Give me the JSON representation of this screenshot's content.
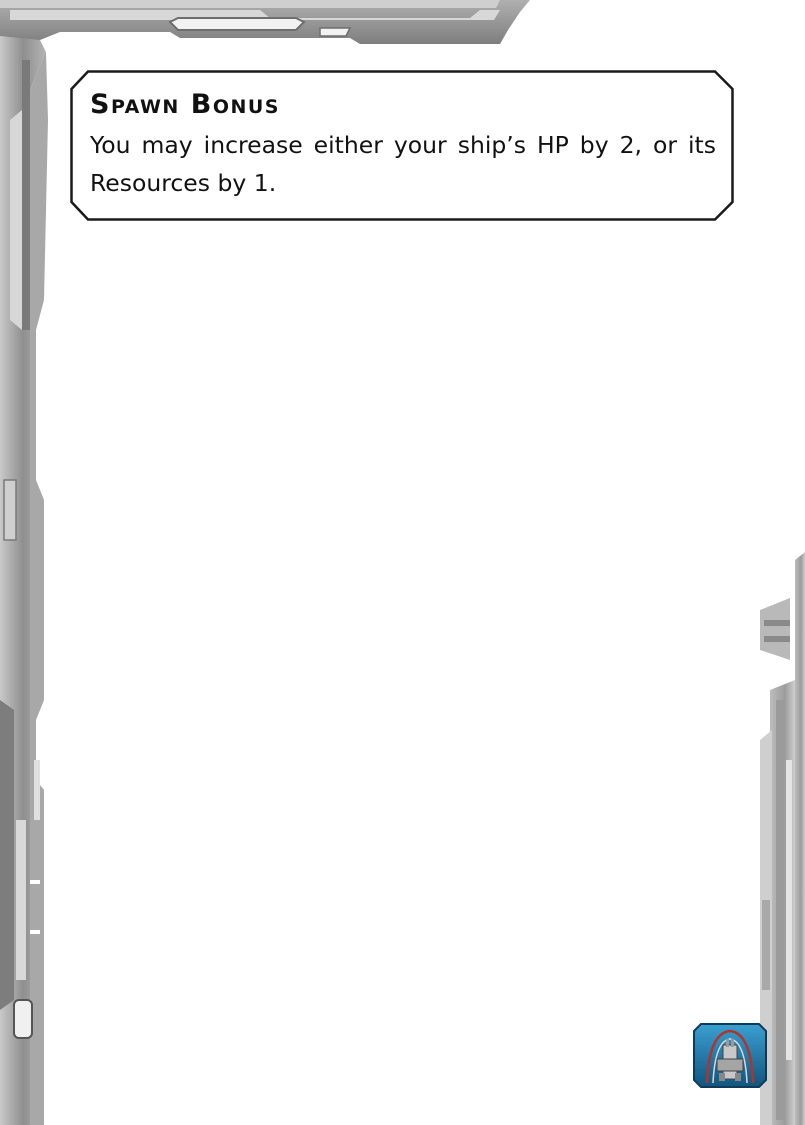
{
  "card": {
    "ability": {
      "title": "Spawn Bonus",
      "text": "You may increase either your ship’s HP by 2, or its Resources by 1."
    },
    "frame_icon": "ship-arch-emblem-icon",
    "colors": {
      "frame_gray": "#9a9a9a",
      "frame_light": "#d2d2d2",
      "box_border": "#1a1a1a",
      "emblem_blue": "#2b87b8",
      "emblem_dark": "#0e3b57",
      "arch_red": "#b0342a"
    }
  }
}
